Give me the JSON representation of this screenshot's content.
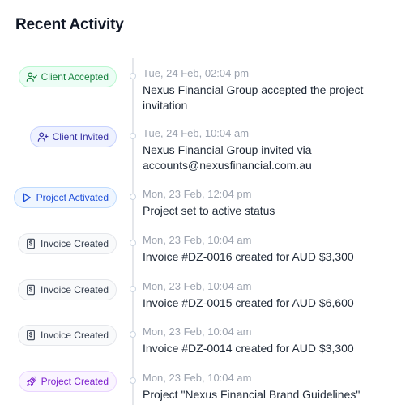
{
  "title": "Recent Activity",
  "activities": [
    {
      "badge": "Client Accepted",
      "icon": "user-check-icon",
      "color": "#15803d",
      "time": "Tue, 24 Feb, 02:04 pm",
      "description": "Nexus Financial Group accepted the project invitation"
    },
    {
      "badge": "Client Invited",
      "icon": "user-plus-icon",
      "color": "#3730a3",
      "time": "Tue, 24 Feb, 10:04 am",
      "description": "Nexus Financial Group invited via accounts@nexusfinancial.com.au"
    },
    {
      "badge": "Project Activated",
      "icon": "play-icon",
      "color": "#1d4ed8",
      "time": "Mon, 23 Feb, 12:04 pm",
      "description": "Project set to active status"
    },
    {
      "badge": "Invoice Created",
      "icon": "invoice-icon",
      "color": "#374151",
      "time": "Mon, 23 Feb, 10:04 am",
      "description": "Invoice #DZ-0016 created for AUD $3,300"
    },
    {
      "badge": "Invoice Created",
      "icon": "invoice-icon",
      "color": "#374151",
      "time": "Mon, 23 Feb, 10:04 am",
      "description": "Invoice #DZ-0015 created for AUD $6,600"
    },
    {
      "badge": "Invoice Created",
      "icon": "invoice-icon",
      "color": "#374151",
      "time": "Mon, 23 Feb, 10:04 am",
      "description": "Invoice #DZ-0014 created for AUD $3,300"
    },
    {
      "badge": "Project Created",
      "icon": "rocket-icon",
      "color": "#7e22ce",
      "time": "Mon, 23 Feb, 10:04 am",
      "description": "Project \"Nexus Financial Brand Guidelines\""
    }
  ]
}
